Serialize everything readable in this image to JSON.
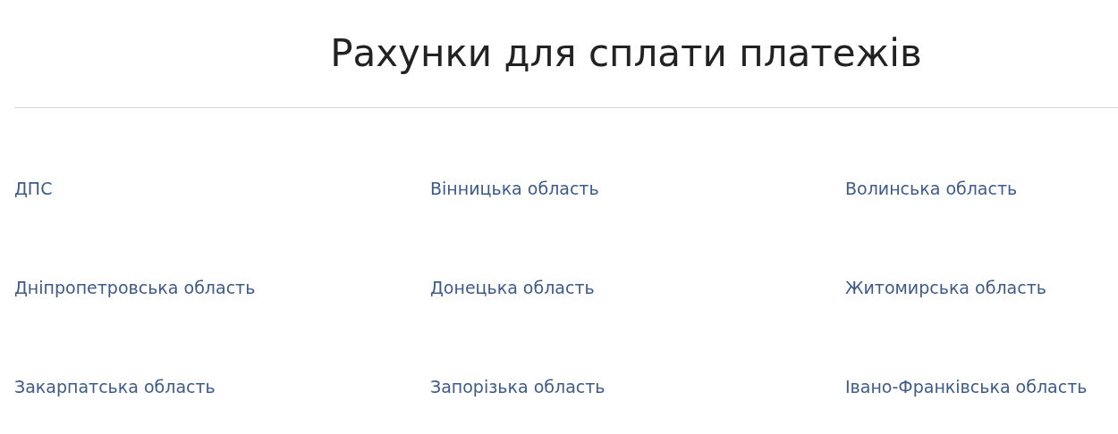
{
  "title": "Рахунки для сплати платежів",
  "links": [
    {
      "label": "ДПС"
    },
    {
      "label": "Вінницька область"
    },
    {
      "label": "Волинська область"
    },
    {
      "label": "Дніпропетровська область"
    },
    {
      "label": "Донецька область"
    },
    {
      "label": "Житомирська область"
    },
    {
      "label": "Закарпатська область"
    },
    {
      "label": "Запорізька область"
    },
    {
      "label": "Івано-Франківська область"
    }
  ]
}
